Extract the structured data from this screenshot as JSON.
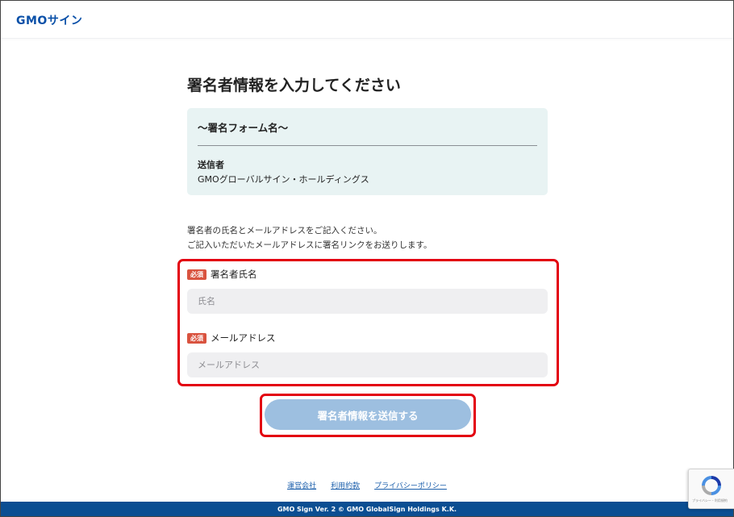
{
  "header": {
    "logo_text": "GMOサイン"
  },
  "page": {
    "title": "署名者情報を入力してください"
  },
  "form_card": {
    "form_name": "〜署名フォーム名〜",
    "sender_label": "送信者",
    "sender_value": "GMOグローバルサイン・ホールディングス"
  },
  "instructions": {
    "line1": "署名者の氏名とメールアドレスをご記入ください。",
    "line2": "ご記入いただいたメールアドレスに署名リンクをお送りします。"
  },
  "fields": {
    "name": {
      "badge": "必須",
      "label": "署名者氏名",
      "placeholder": "氏名",
      "value": ""
    },
    "email": {
      "badge": "必須",
      "label": "メールアドレス",
      "placeholder": "メールアドレス",
      "value": ""
    }
  },
  "submit": {
    "label": "署名者情報を送信する",
    "color": "#9dbfe0"
  },
  "footer": {
    "links": [
      "運営会社",
      "利用約款",
      "プライバシーポリシー"
    ],
    "copyright": "GMO Sign Ver. 2  © GMO GlobalSign Holdings K.K."
  },
  "recaptcha": {
    "icon": "recaptcha-icon",
    "text": "プライバシー・利用規約"
  },
  "colors": {
    "brand": "#0a50a8",
    "highlight": "#e3000f",
    "badge": "#d9533f",
    "footer_bg": "#0b4e92",
    "card_bg": "#e8f3f3"
  }
}
